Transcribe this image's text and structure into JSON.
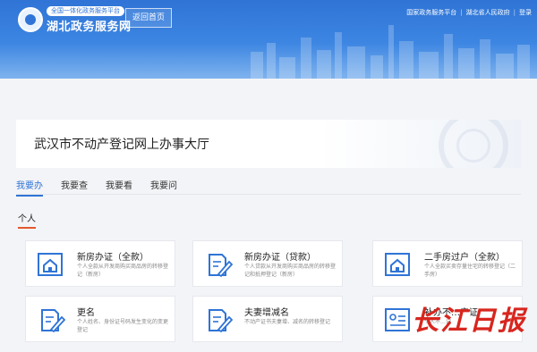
{
  "header": {
    "logo_tag": "全国一体化政务服务平台",
    "logo_title": "湖北政务服务网",
    "home_button": "返回首页",
    "links": [
      "国家政务服务平台",
      "湖北省人民政府",
      "登录"
    ]
  },
  "banner": {
    "title": "武汉市不动产登记网上办事大厅"
  },
  "tabs": [
    "我要办",
    "我要查",
    "我要看",
    "我要问"
  ],
  "section_title": "个人",
  "cards": [
    {
      "title": "新房办证（全款）",
      "desc": "个人全款从开发商购买商品房的转移登记（新房）",
      "icon": "house-certificate-icon"
    },
    {
      "title": "新房办证（贷款）",
      "desc": "个人贷款从开发商购买商品房的转移登记和抵押登记（新房）",
      "icon": "pen-document-icon"
    },
    {
      "title": "二手房过户（全款）",
      "desc": "个人全款买卖存量住宅的转移登记（二手房）",
      "icon": "house-certificate-icon"
    },
    {
      "title": "更名",
      "desc": "个人姓名、身份证号码发生变化的变更登记",
      "icon": "pen-document-icon"
    },
    {
      "title": "夫妻增减名",
      "desc": "不动产证书夫妻增、减名的转移登记",
      "icon": "pen-document-icon"
    },
    {
      "title": "补办不…产证",
      "desc": "个人不…记",
      "icon": "id-card-icon"
    }
  ],
  "watermark": "长江日报",
  "colors": {
    "accent": "#2f74d6",
    "section_underline": "#e4572e",
    "watermark": "#d7261e"
  }
}
